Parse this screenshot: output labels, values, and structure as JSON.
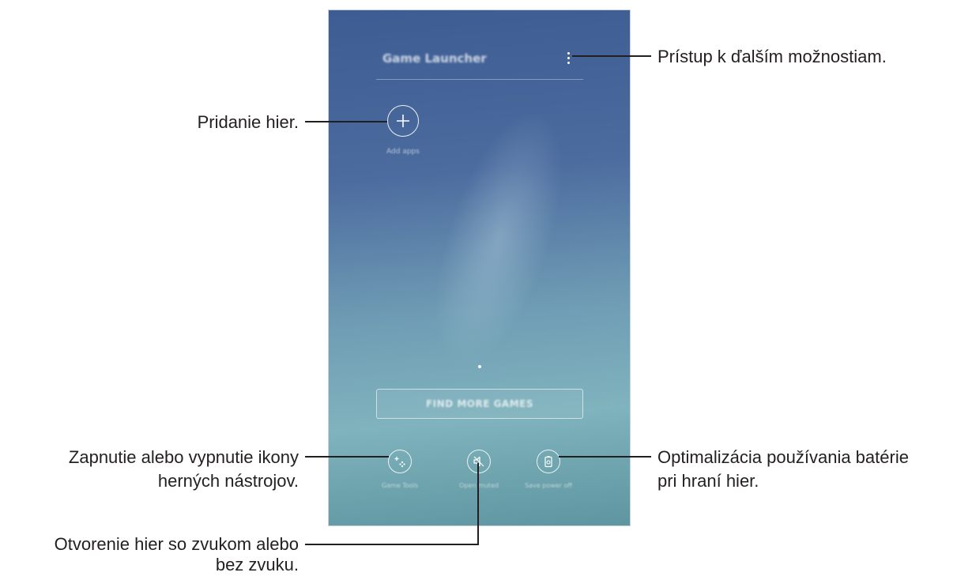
{
  "screen": {
    "app_title": "Game Launcher",
    "more_options_icon": "more-vertical-icon",
    "add_apps_label": "Add apps",
    "find_more_games_label": "FIND MORE GAMES",
    "bottom_buttons": [
      {
        "icon": "game-tools-icon",
        "label": "Game Tools"
      },
      {
        "icon": "mute-icon",
        "label": "Open muted"
      },
      {
        "icon": "battery-gear-icon",
        "label": "Save power off"
      }
    ]
  },
  "callouts": {
    "more_options": "Prístup k ďalším možnostiam.",
    "add_games": "Pridanie hier.",
    "game_tools_line1": "Zapnutie alebo vypnutie ikony",
    "game_tools_line2": "herných nástrojov.",
    "sound_line1": "Otvorenie hier so zvukom alebo",
    "sound_line2": "bez zvuku.",
    "battery_line1": "Optimalizácia používania batérie",
    "battery_line2": "pri hraní hier."
  }
}
